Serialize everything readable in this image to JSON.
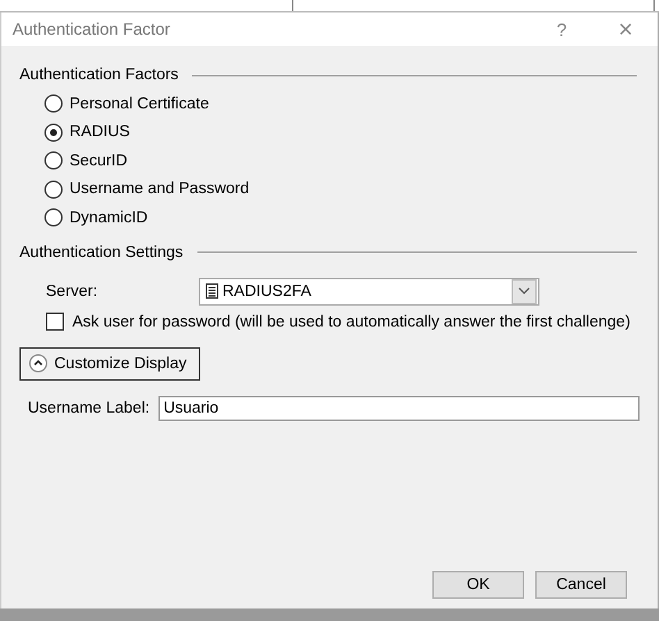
{
  "window": {
    "title": "Authentication Factor",
    "help": "?",
    "close": "×"
  },
  "factors": {
    "title": "Authentication Factors",
    "options": [
      {
        "label": "Personal Certificate",
        "selected": false
      },
      {
        "label": "RADIUS",
        "selected": true
      },
      {
        "label": "SecurID",
        "selected": false
      },
      {
        "label": "Username and Password",
        "selected": false
      },
      {
        "label": "DynamicID",
        "selected": false
      }
    ]
  },
  "settings": {
    "title": "Authentication Settings",
    "server_label": "Server:",
    "server_value": "RADIUS2FA",
    "ask_password": {
      "label": "Ask user for password (will be used to automatically answer the first challenge)",
      "checked": false
    }
  },
  "customize": {
    "label": "Customize Display",
    "expanded": true,
    "username_label": "Username Label:",
    "username_value": "Usuario"
  },
  "buttons": [
    "OK",
    "Cancel"
  ]
}
